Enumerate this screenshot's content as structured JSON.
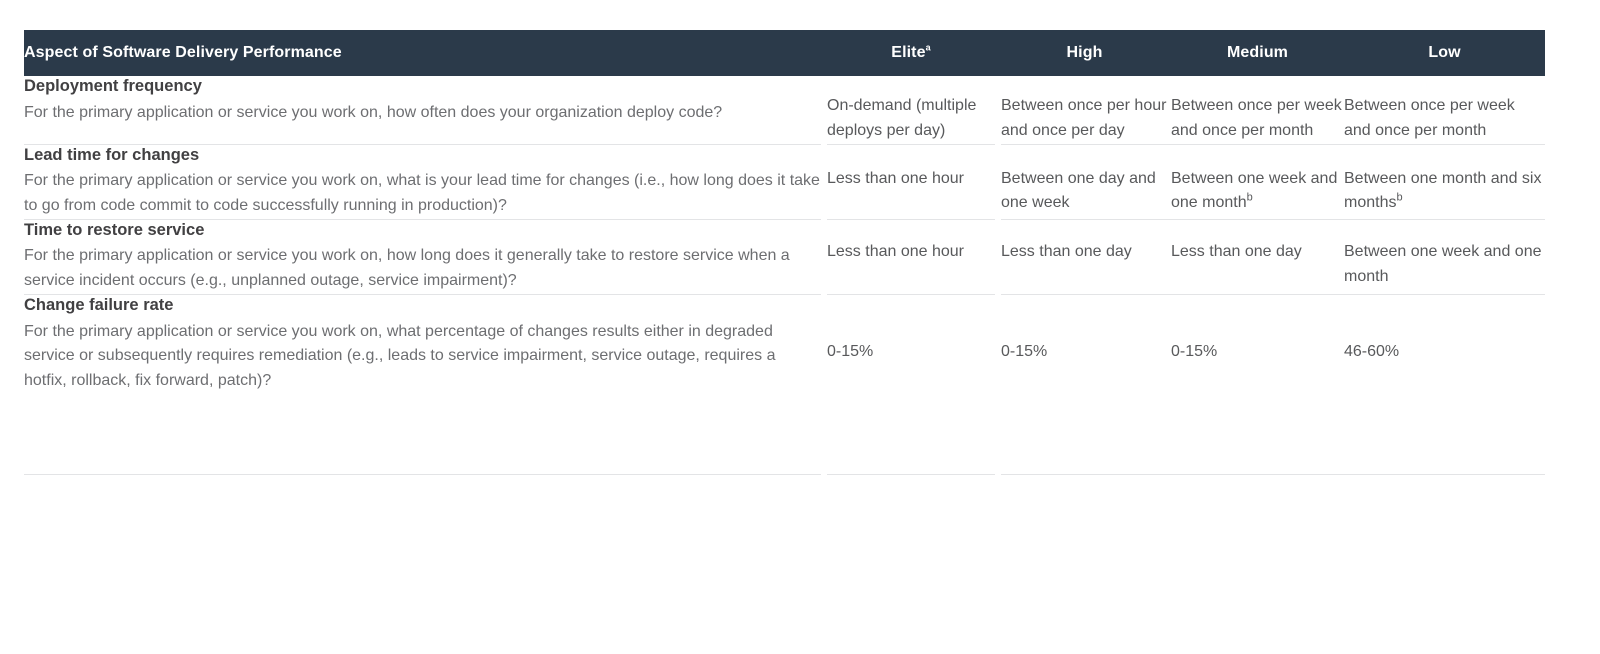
{
  "table": {
    "columns": [
      {
        "key": "aspect",
        "label": "Aspect of Software Delivery Performance",
        "highlight": false
      },
      {
        "key": "elite",
        "label": "Elite",
        "superscript": "a",
        "highlight": true
      },
      {
        "key": "high",
        "label": "High",
        "highlight": false
      },
      {
        "key": "medium",
        "label": "Medium",
        "highlight": false
      },
      {
        "key": "low",
        "label": "Low",
        "highlight": false
      }
    ],
    "rows": [
      {
        "title": "Deployment frequency",
        "description": "For the primary application or service you work on, how often does your organization deploy code?",
        "elite": "On-demand (multiple deploys per day)",
        "high": "Between once per hour and once per day",
        "medium": "Between once per week and once per month",
        "low": "Between once per week and once per month"
      },
      {
        "title": "Lead time for changes",
        "description": "For the primary application or service you work on, what is your lead time for changes (i.e., how long does it take to go from code commit to code successfully running in production)?",
        "elite": "Less than one hour",
        "high": "Between one day and one week",
        "medium": "Between one week and one month",
        "medium_sup": "b",
        "low": "Between one month and six months",
        "low_sup": "b"
      },
      {
        "title": "Time to restore service",
        "description": "For the primary application or service you work on, how long does it generally take to restore service when a service incident occurs (e.g., unplanned outage, service impairment)?",
        "elite": "Less than one hour",
        "high": "Less than one day",
        "medium": "Less than one day",
        "low": "Between one week and one month"
      },
      {
        "title": "Change failure rate",
        "description": "For the primary application or service you work on, what percentage of changes results either in degraded service or subsequently requires remediation (e.g., leads to service impairment, service outage, requires a hotfix, rollback, fix forward, patch)?",
        "elite": "0-15%",
        "high": "0-15%",
        "medium": "0-15%",
        "low": "46-60%"
      }
    ]
  },
  "colors": {
    "header_background": "#2b3a4a",
    "elite_header_background": "#8cc63f",
    "elite_cell_background": "#eff4e3",
    "header_text": "#ffffff",
    "elite_header_text": "#1d2a36",
    "title_text": "#414042",
    "body_text": "#6d6e71",
    "value_text": "#58595b",
    "row_divider": "#e3e4e6",
    "page_background": "#ffffff"
  }
}
